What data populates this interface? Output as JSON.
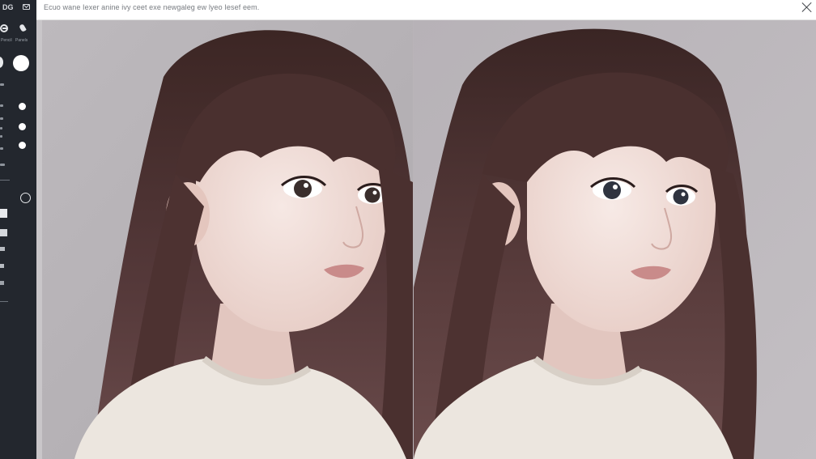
{
  "app": {
    "prompt_text": "Ecuo wane Iexer anine ivy ceet exe newgaleg ew lyeo Iesef eem.",
    "close_icon": "close-icon"
  },
  "sidebar": {
    "top_label": "DG",
    "top_icon": "mail-icon",
    "tool_labels": [
      "Pencil",
      "Panels"
    ],
    "tools": [
      {
        "icon": "erase-tool-icon"
      },
      {
        "icon": "brush-tool-icon"
      },
      {
        "icon": "brush-size-large-icon"
      },
      {
        "icon": "brush-size-medium-icon"
      },
      {
        "icon": "brush-size-small-icon"
      },
      {
        "icon": "brush-size-tiny-icon"
      },
      {
        "icon": "circle-tool-icon"
      },
      {
        "icon": "square-swatch-icon"
      }
    ],
    "colors": {
      "background": "#23272e",
      "foreground": "#e8eaed"
    }
  },
  "canvas": {
    "background": "#c9c6c9",
    "images": [
      {
        "name": "before-image",
        "subject": "portrait-girl-long-brown-hair-white-sweater"
      },
      {
        "name": "after-image",
        "subject": "portrait-girl-long-brown-hair-white-sweater"
      }
    ]
  }
}
